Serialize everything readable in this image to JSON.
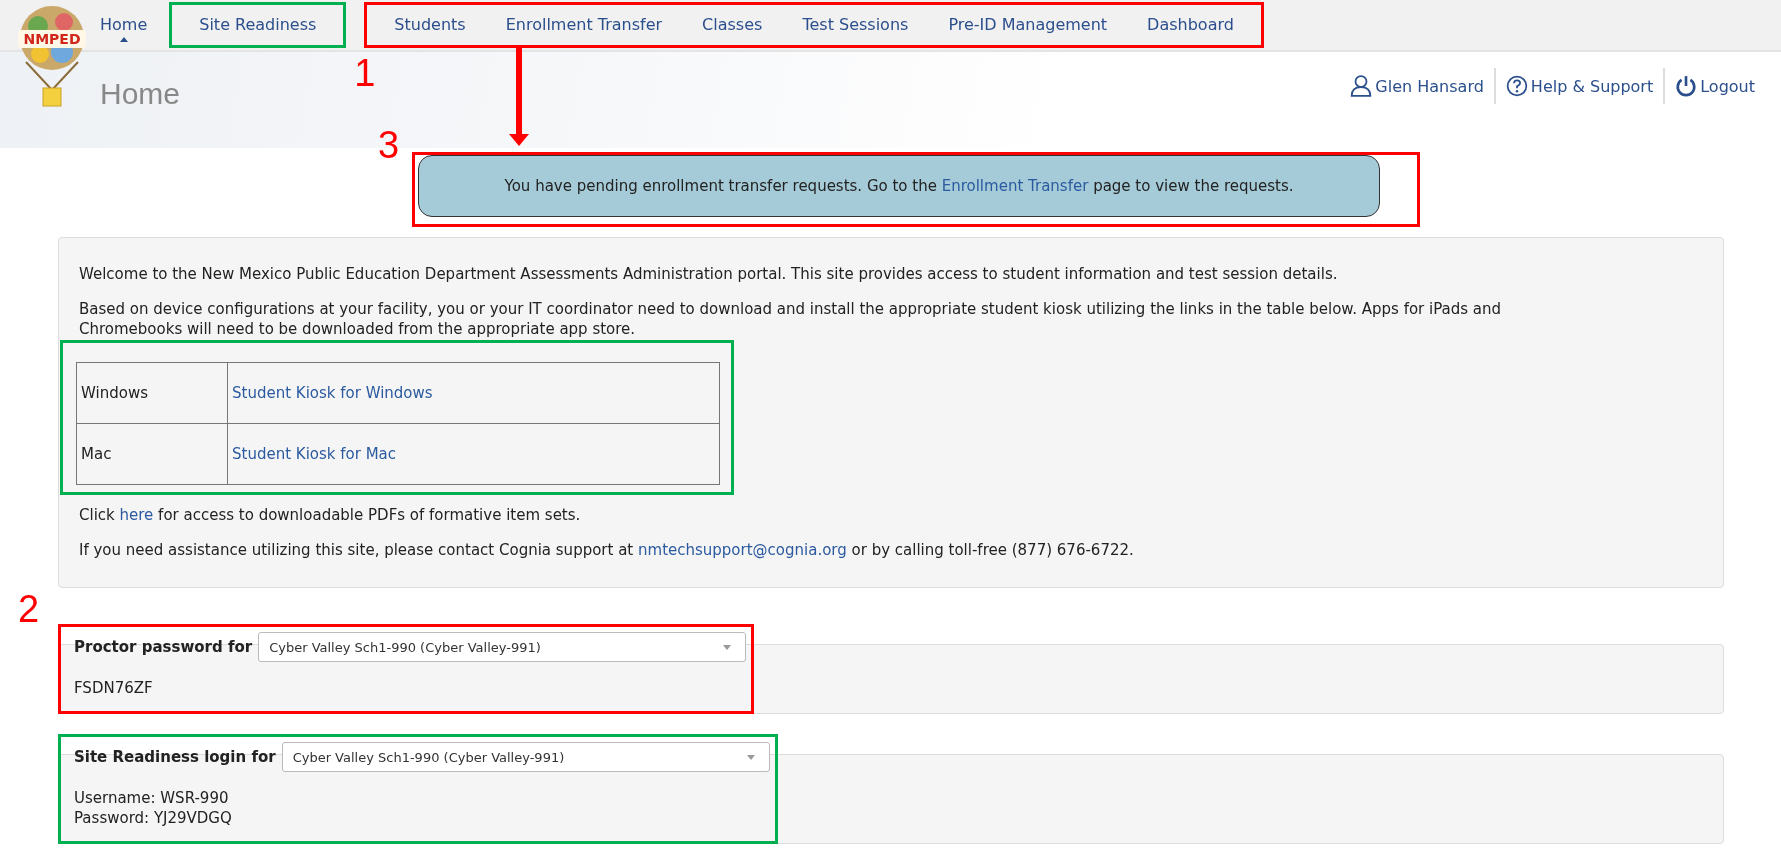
{
  "logo": {
    "text": "NMPED"
  },
  "nav": {
    "groups": [
      {
        "items": [
          {
            "label": "Home",
            "selected": true
          }
        ]
      },
      {
        "annotation": {
          "color": "#00b050"
        },
        "items": [
          {
            "label": "Site Readiness",
            "selected": false
          }
        ]
      },
      {
        "annotation": {
          "color": "#ff0000",
          "number": "1",
          "arrow": true
        },
        "items": [
          {
            "label": "Students",
            "selected": false
          },
          {
            "label": "Enrollment Transfer",
            "selected": false
          },
          {
            "label": "Classes",
            "selected": false
          },
          {
            "label": "Test Sessions",
            "selected": false
          },
          {
            "label": "Pre-ID Management",
            "selected": false
          },
          {
            "label": "Dashboard",
            "selected": false
          }
        ]
      }
    ]
  },
  "page_title": "Home",
  "user_links": [
    {
      "kind": "user",
      "label": "Glen Hansard"
    },
    {
      "kind": "help",
      "label": "Help & Support"
    },
    {
      "kind": "logout",
      "label": "Logout"
    }
  ],
  "banner": {
    "annotation": {
      "color": "#ff0000",
      "number": "3"
    },
    "before": "You have pending enrollment transfer requests. Go to the",
    "link": "Enrollment Transfer",
    "after": "page to view the requests."
  },
  "welcome": {
    "paragraphs": [
      "Welcome to the New Mexico Public Education Department Assessments Administration portal. This site provides access to student information and test session details.",
      "Based on device configurations at your facility, you or your IT coordinator need to download and install the appropriate student kiosk utilizing the links in the table below. Apps for iPads and Chromebooks will need to be downloaded from the appropriate app store."
    ],
    "kiosk_table": {
      "annotation": {
        "color": "#00b050"
      },
      "rows": [
        {
          "platform": "Windows",
          "link": "Student Kiosk for Windows"
        },
        {
          "platform": "Mac",
          "link": "Student Kiosk for Mac"
        }
      ]
    },
    "pdf_line": {
      "before": "Click",
      "link": "here",
      "after": "for access to downloadable PDFs of formative item sets."
    },
    "contact_line": {
      "before": "If you need assistance utilizing this site, please contact Cognia support at",
      "link": "nmtechsupport@cognia.org",
      "after": "or by calling toll-free (877) 676-6722."
    }
  },
  "sections": [
    {
      "annotation": {
        "color": "#ff0000",
        "number": "2"
      },
      "label": "Proctor password for",
      "select": "Cyber Valley Sch1-990 (Cyber Valley-991)",
      "lines": [
        "FSDN76ZF"
      ]
    },
    {
      "annotation": {
        "color": "#00b050"
      },
      "label": "Site Readiness login for",
      "select": "Cyber Valley Sch1-990 (Cyber Valley-991)",
      "lines": [
        "Username: WSR-990",
        "Password: YJ29VDGQ"
      ]
    }
  ]
}
